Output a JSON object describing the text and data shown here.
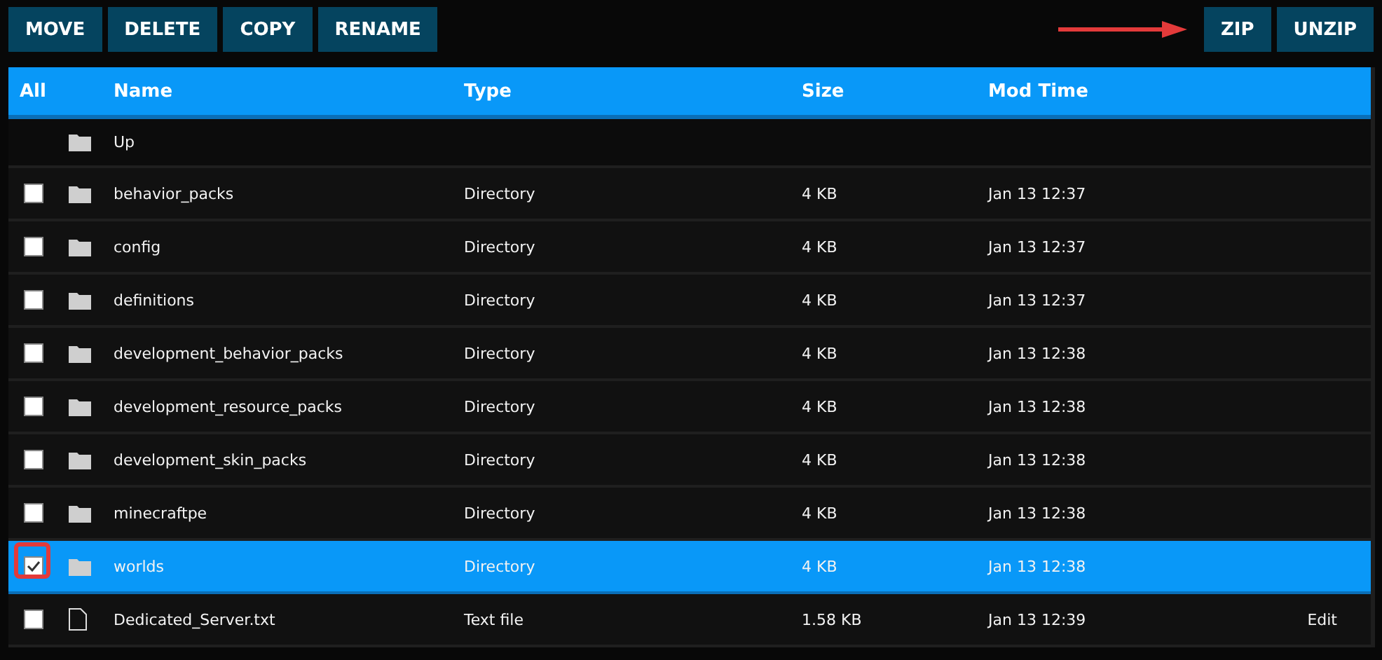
{
  "toolbar": {
    "left_buttons": [
      "MOVE",
      "DELETE",
      "COPY",
      "RENAME"
    ],
    "right_buttons": [
      "ZIP",
      "UNZIP"
    ]
  },
  "table": {
    "columns": [
      "All",
      "Name",
      "Type",
      "Size",
      "Mod Time"
    ],
    "rows": [
      {
        "kind": "up",
        "name": "Up"
      },
      {
        "kind": "folder",
        "name": "behavior_packs",
        "type": "Directory",
        "size": "4 KB",
        "time": "Jan 13 12:37",
        "selected": false,
        "checked": false
      },
      {
        "kind": "folder",
        "name": "config",
        "type": "Directory",
        "size": "4 KB",
        "time": "Jan 13 12:37",
        "selected": false,
        "checked": false
      },
      {
        "kind": "folder",
        "name": "definitions",
        "type": "Directory",
        "size": "4 KB",
        "time": "Jan 13 12:37",
        "selected": false,
        "checked": false
      },
      {
        "kind": "folder",
        "name": "development_behavior_packs",
        "type": "Directory",
        "size": "4 KB",
        "time": "Jan 13 12:38",
        "selected": false,
        "checked": false
      },
      {
        "kind": "folder",
        "name": "development_resource_packs",
        "type": "Directory",
        "size": "4 KB",
        "time": "Jan 13 12:38",
        "selected": false,
        "checked": false
      },
      {
        "kind": "folder",
        "name": "development_skin_packs",
        "type": "Directory",
        "size": "4 KB",
        "time": "Jan 13 12:38",
        "selected": false,
        "checked": false
      },
      {
        "kind": "folder",
        "name": "minecraftpe",
        "type": "Directory",
        "size": "4 KB",
        "time": "Jan 13 12:38",
        "selected": false,
        "checked": false
      },
      {
        "kind": "folder",
        "name": "worlds",
        "type": "Directory",
        "size": "4 KB",
        "time": "Jan 13 12:38",
        "selected": true,
        "checked": true
      },
      {
        "kind": "file",
        "name": "Dedicated_Server.txt",
        "type": "Text file",
        "size": "1.58 KB",
        "time": "Jan 13 12:39",
        "selected": false,
        "checked": false,
        "action": "Edit"
      }
    ]
  }
}
